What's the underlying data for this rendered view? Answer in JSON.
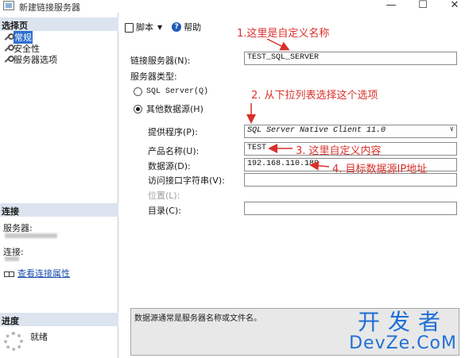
{
  "window": {
    "title": "新建链接服务器",
    "minimize": "—",
    "maximize": "☐",
    "close": "✕"
  },
  "left": {
    "select_page_header": "选择页",
    "pages": [
      {
        "label": "常规",
        "active": true
      },
      {
        "label": "安全性",
        "active": false
      },
      {
        "label": "服务器选项",
        "active": false
      }
    ],
    "connection_header": "连接",
    "server_label": "服务器:",
    "connection_label": "连接:",
    "view_conn_props": "查看连接属性",
    "progress_header": "进度",
    "status": "就绪"
  },
  "toolbar": {
    "script_label": "脚本",
    "help_label": "帮助"
  },
  "form": {
    "linked_server_label": "链接服务器(N):",
    "linked_server_value": "TEST_SQL_SERVER",
    "server_type_label": "服务器类型:",
    "radio_sql_server": "SQL Server(Q)",
    "radio_other": "其他数据源(H)",
    "provider_label": "提供程序(P):",
    "provider_value": "SQL Server Native Client 11.0",
    "product_name_label": "产品名称(U):",
    "product_name_value": "TEST",
    "data_source_label": "数据源(D):",
    "data_source_value": "192.168.110.189",
    "provider_string_label": "访问接口字符串(V):",
    "provider_string_value": "",
    "location_label": "位置(L):",
    "location_value": "",
    "catalog_label": "目录(C):",
    "catalog_value": "",
    "description": "数据源通常是服务器名称或文件名。"
  },
  "annotations": {
    "a1": "1.这里是自定义名称",
    "a2": "2. 从下拉列表选择这个选项",
    "a3": "3. 这里自定义内容",
    "a4": "4. 目标数据源IP地址",
    "color": "#d9302a"
  },
  "watermark": {
    "cn": "开发者",
    "en": "DevZe.CoM",
    "color": "#1f6fd4"
  }
}
